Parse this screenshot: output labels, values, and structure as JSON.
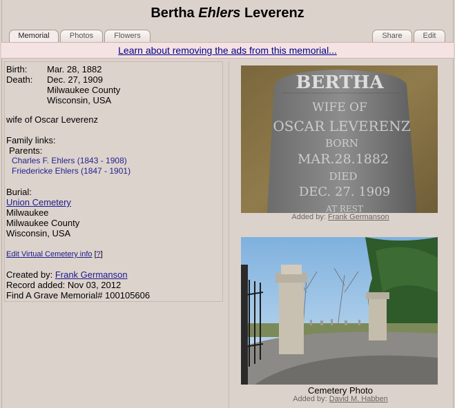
{
  "page": {
    "title_first": "Bertha",
    "title_middle": "Ehlers",
    "title_last": "Leverenz"
  },
  "tabs": {
    "memorial": "Memorial",
    "photos": "Photos",
    "flowers": "Flowers",
    "share": "Share",
    "edit": "Edit"
  },
  "ad_notice": "Learn about removing the ads from this memorial...",
  "vitals": {
    "birth_label": "Birth:",
    "birth_date": "Mar. 28, 1882",
    "death_label": "Death:",
    "death_date": "Dec. 27, 1909",
    "death_county": "Milwaukee County",
    "death_state": "Wisconsin, USA"
  },
  "bio": "wife of Oscar Leverenz",
  "family": {
    "heading": "Family links:",
    "parents_label": "Parents:",
    "parents": [
      "Charles F. Ehlers (1843 - 1908)",
      "Friedericke Ehlers (1847 - 1901)"
    ]
  },
  "burial": {
    "label": "Burial:",
    "cemetery": "Union Cemetery",
    "city": "Milwaukee",
    "county": "Milwaukee County",
    "state": "Wisconsin, USA"
  },
  "virtual": {
    "link": "Edit Virtual Cemetery info",
    "help_open": "[",
    "help": "?",
    "help_close": "]"
  },
  "record": {
    "created_label": "Created by:",
    "created_by": "Frank Germanson",
    "added": "Record added: Nov 03, 2012",
    "memorial_id": "Find A Grave Memorial# 100105606"
  },
  "photos": {
    "headstone": {
      "added_label": "Added by:",
      "added_by": "Frank Germanson",
      "stone_lines": [
        "BERTHA",
        "WIFE OF",
        "OSCAR LEVERENZ",
        "BORN",
        "MAR.28.1882",
        "DIED",
        "DEC. 27. 1909",
        "AT REST"
      ]
    },
    "cemetery": {
      "caption": "Cemetery Photo",
      "added_label": "Added by:",
      "added_by": "David M. Habben"
    }
  }
}
